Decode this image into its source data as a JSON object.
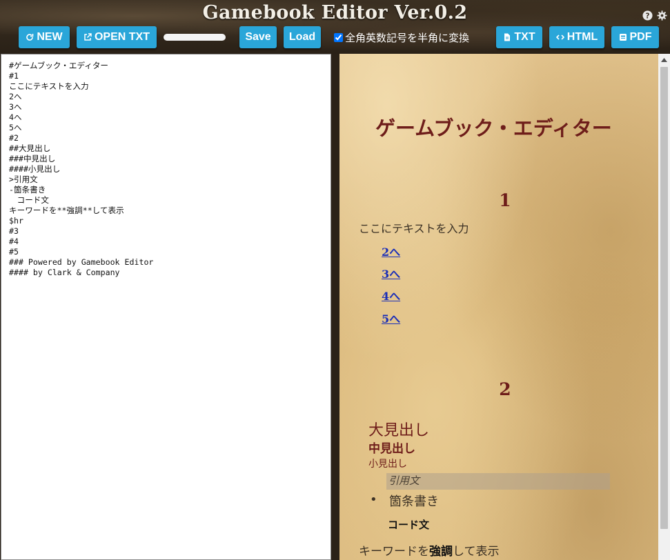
{
  "app": {
    "title": "Gamebook Editor Ver.0.2"
  },
  "toolbar": {
    "new_label": "NEW",
    "open_label": "OPEN TXT",
    "save_label": "Save",
    "load_label": "Load",
    "convert_label": "全角英数記号を半角に変換",
    "convert_checked": true,
    "txt_label": "TXT",
    "html_label": "HTML",
    "pdf_label": "PDF"
  },
  "icons": {
    "help": "question-circle-icon",
    "settings": "gear-icon",
    "new": "refresh-icon",
    "open": "external-link-icon",
    "txt": "file-icon",
    "html": "code-icon",
    "pdf": "pdf-icon"
  },
  "editor": {
    "lines": [
      "#ゲームブック・エディター",
      "#1",
      "ここにテキストを入力",
      "2へ",
      "3へ",
      "4へ",
      "5へ",
      "#2",
      "##大見出し",
      "###中見出し",
      "####小見出し",
      ">引用文",
      "-箇条書き",
      "　コード文",
      "キーワードを**強調**して表示",
      "$hr",
      "#3",
      "#4",
      "#5",
      "### Powered by Gamebook Editor",
      "#### by Clark & Company"
    ]
  },
  "preview": {
    "title": "ゲームブック・エディター",
    "section1": {
      "number": "1",
      "text": "ここにテキストを入力",
      "links": [
        "2へ",
        "3へ",
        "4へ",
        "5へ"
      ]
    },
    "section2": {
      "number": "2",
      "h2": "大見出し",
      "h3": "中見出し",
      "h4": "小見出し",
      "quote": "引用文",
      "bullet": "箇条書き",
      "code": "コード文",
      "emphasis_before": "キーワードを",
      "emphasis_strong": "強調",
      "emphasis_after": "して表示"
    }
  },
  "colors": {
    "button": "#2aa6d9",
    "heading": "#6e1d1a",
    "link": "#1b2fb8"
  }
}
